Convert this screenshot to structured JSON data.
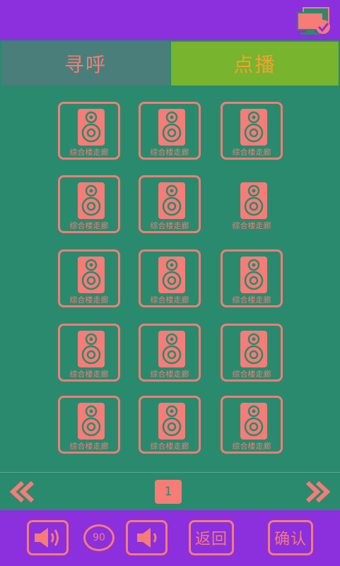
{
  "tabs": {
    "page_label": "寻呼",
    "broadcast_label": "点播"
  },
  "speakers": [
    "综合楼走廊",
    "综合楼走廊",
    "综合楼走廊",
    "综合楼走廊",
    "综合楼走廊",
    "综合楼走廊",
    "综合楼走廊",
    "综合楼走廊",
    "综合楼走廊",
    "综合楼走廊",
    "综合楼走廊",
    "综合楼走廊",
    "综合楼走廊",
    "综合楼走廊",
    "综合楼走廊"
  ],
  "pager": {
    "current_page": "1"
  },
  "controls": {
    "volume_level": "90",
    "back_label": "返回",
    "confirm_label": "确认"
  },
  "icons": [
    "monitor-check-icon",
    "speaker-icon",
    "double-chevron-left-icon",
    "double-chevron-right-icon",
    "volume-up-icon",
    "volume-down-icon"
  ],
  "colors": {
    "accent": "#f57c77",
    "background": "#2a8a6e",
    "bar": "#8c2fdc",
    "tab_active": "#78b42d"
  }
}
